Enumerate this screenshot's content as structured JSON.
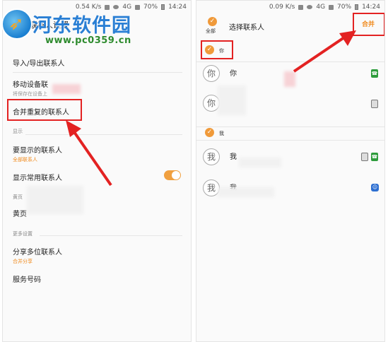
{
  "watermark": {
    "title": "河东软件园",
    "url": "www.pc0359.cn"
  },
  "left_screen": {
    "status": {
      "speed": "0.54 K/s",
      "net": "4G",
      "battery": "70%",
      "time": "14:24"
    },
    "title": "联系人设置",
    "item_import_export": "导入/导出联系人",
    "item_move": {
      "title": "移动设备联",
      "sub": "将保存在设备上"
    },
    "item_merge": "合并重复的联系人",
    "section_display": "显示",
    "item_display": {
      "title": "要显示的联系人",
      "sub": "全部联系人"
    },
    "item_frequent": "显示常用联系人",
    "frequent_on": true,
    "section_yellow": "黄页",
    "item_yellow": "黄页",
    "section_more": "更多设置",
    "item_share": {
      "title": "分享多位联系人",
      "sub": "合并分享"
    },
    "item_service": "服务号码"
  },
  "right_screen": {
    "status": {
      "speed": "0.09 K/s",
      "net": "4G",
      "battery": "70%",
      "time": "14:24"
    },
    "select_all": "全部",
    "title": "选择联系人",
    "merge": "合并",
    "group1": {
      "label": "你",
      "contacts": [
        {
          "avatar": "你",
          "name": "你",
          "icon": "phone-icon"
        },
        {
          "avatar": "你",
          "name": "",
          "icon": "sim-icon"
        }
      ]
    },
    "group2": {
      "label": "我",
      "contacts": [
        {
          "avatar": "我",
          "name": "我",
          "icon": "sim-phone-icon"
        },
        {
          "avatar": "我",
          "name": "我",
          "icon": "contact-icon"
        }
      ]
    }
  },
  "colors": {
    "accent": "#f08a1c",
    "highlight": "#e32222",
    "watermark_blue": "#2a7fd4",
    "watermark_green": "#2e8b2e"
  }
}
